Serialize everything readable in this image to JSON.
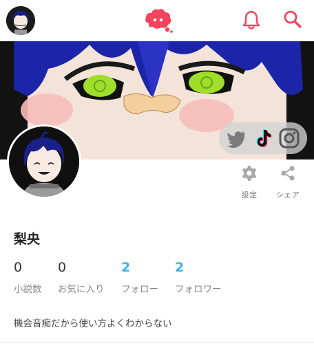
{
  "header": {
    "avatar_icon": "user-avatar-icon",
    "logo_icon": "brand-logo-icon",
    "notification_icon": "bell-icon",
    "search_icon": "search-icon",
    "accent_color": "#f2455d"
  },
  "banner": {
    "social": [
      "twitter-icon",
      "tiktok-icon",
      "instagram-icon"
    ]
  },
  "actions": [
    {
      "label": "設定",
      "icon": "gear-icon"
    },
    {
      "label": "シェア",
      "icon": "share-icon"
    }
  ],
  "profile": {
    "name": "梨央",
    "bio": "機会音痴だから使い方よくわからない"
  },
  "stats": [
    {
      "count": "0",
      "label": "小説数"
    },
    {
      "count": "0",
      "label": "お気に入り"
    },
    {
      "count": "2",
      "label": "フォロー"
    },
    {
      "count": "2",
      "label": "フォロワー"
    }
  ],
  "colors": {
    "link": "#3bb4e8",
    "text_muted": "#888888"
  }
}
